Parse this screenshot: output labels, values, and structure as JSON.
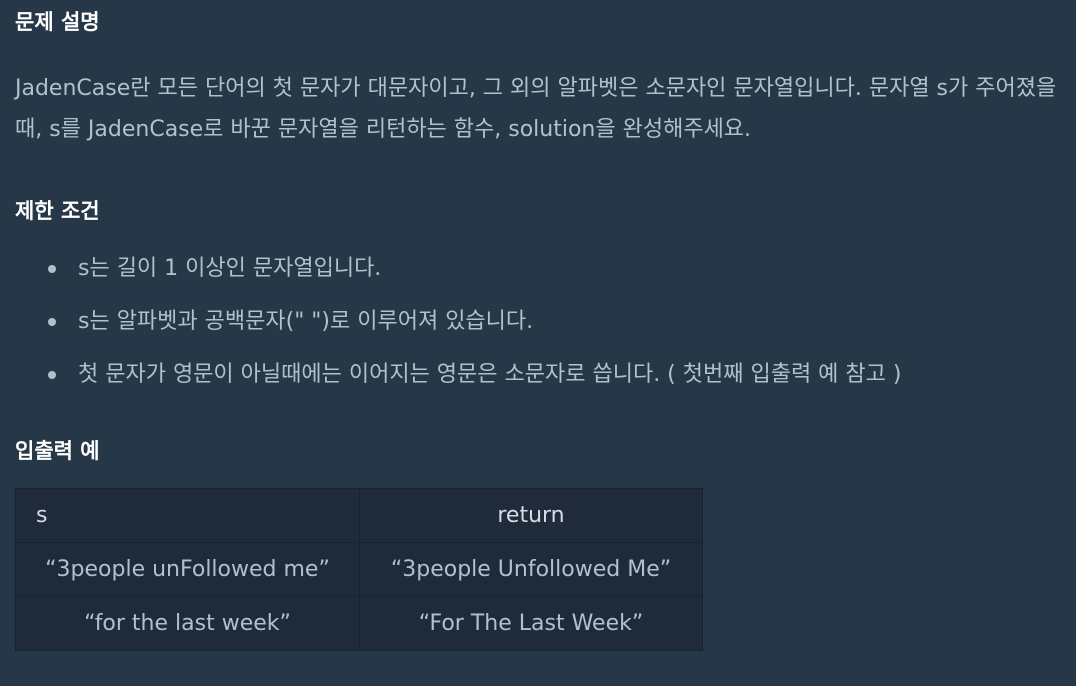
{
  "sections": {
    "description_title": "문제 설명",
    "description": "JadenCase란 모든 단어의 첫 문자가 대문자이고, 그 외의 알파벳은 소문자인 문자열입니다. 문자열 s가 주어졌을 때, s를 JadenCase로 바꾼 문자열을 리턴하는 함수, solution을 완성해주세요.",
    "limits_title": "제한 조건",
    "limits": [
      "s는 길이 1 이상인 문자열입니다.",
      "s는 알파벳과 공백문자(\" \")로 이루어져 있습니다.",
      "첫 문자가 영문이 아닐때에는 이어지는 영문은 소문자로 씁니다. ( 첫번째 입출력 예 참고 )"
    ],
    "io_title": "입출력 예"
  },
  "io_table": {
    "headers": [
      "s",
      "return"
    ],
    "rows": [
      [
        "“3people unFollowed me”",
        "“3people Unfollowed Me”"
      ],
      [
        "“for the last week”",
        "“For The Last Week”"
      ]
    ]
  }
}
